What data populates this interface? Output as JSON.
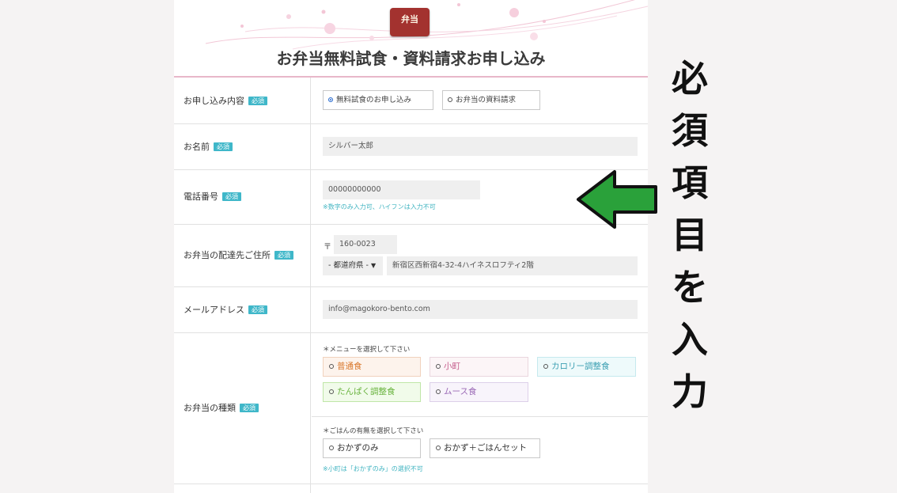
{
  "header": {
    "logo_text": "弁当",
    "title": "お弁当無料試食・資料請求お申し込み"
  },
  "rows": {
    "application": {
      "label": "お申し込み内容",
      "required": "必須",
      "options": [
        "無料試食のお申し込み",
        "お弁当の資料請求"
      ],
      "selected": "無料試食のお申し込み"
    },
    "name": {
      "label": "お名前",
      "required": "必須",
      "value": "シルバー太郎"
    },
    "phone": {
      "label": "電話番号",
      "required": "必須",
      "value": "00000000000",
      "hint": "※数字のみ入力可、ハイフンは入力不可"
    },
    "address": {
      "label": "お弁当の配達先ご住所",
      "required": "必須",
      "postal_mark": "〒",
      "postal_value": "160-0023",
      "prefecture": "- 都道府県 -",
      "street": "新宿区西新宿4-32-4ハイネスロフティ2階"
    },
    "email": {
      "label": "メールアドレス",
      "required": "必須",
      "value": "info@magokoro-bento.com"
    },
    "bento_type": {
      "label": "お弁当の種類",
      "required": "必須",
      "menu_prompt": "＊メニューを選択して下さい",
      "menu_options": [
        "普通食",
        "小町",
        "カロリー調整食",
        "たんぱく調整食",
        "ムース食"
      ],
      "rice_prompt": "＊ごはんの有無を選択して下さい",
      "rice_options": [
        "おかずのみ",
        "おかず＋ごはんセット"
      ],
      "rice_hint": "※小町は「おかずのみ」の選択不可"
    }
  },
  "annotation": {
    "side_text": [
      "必",
      "須",
      "項",
      "目",
      "を",
      "入",
      "力"
    ],
    "arrow_color": "#2aa13a"
  },
  "colors": {
    "required_badge": "#3fb7c9",
    "header_line": "#e8b7c9",
    "hint": "#43b5c2"
  }
}
